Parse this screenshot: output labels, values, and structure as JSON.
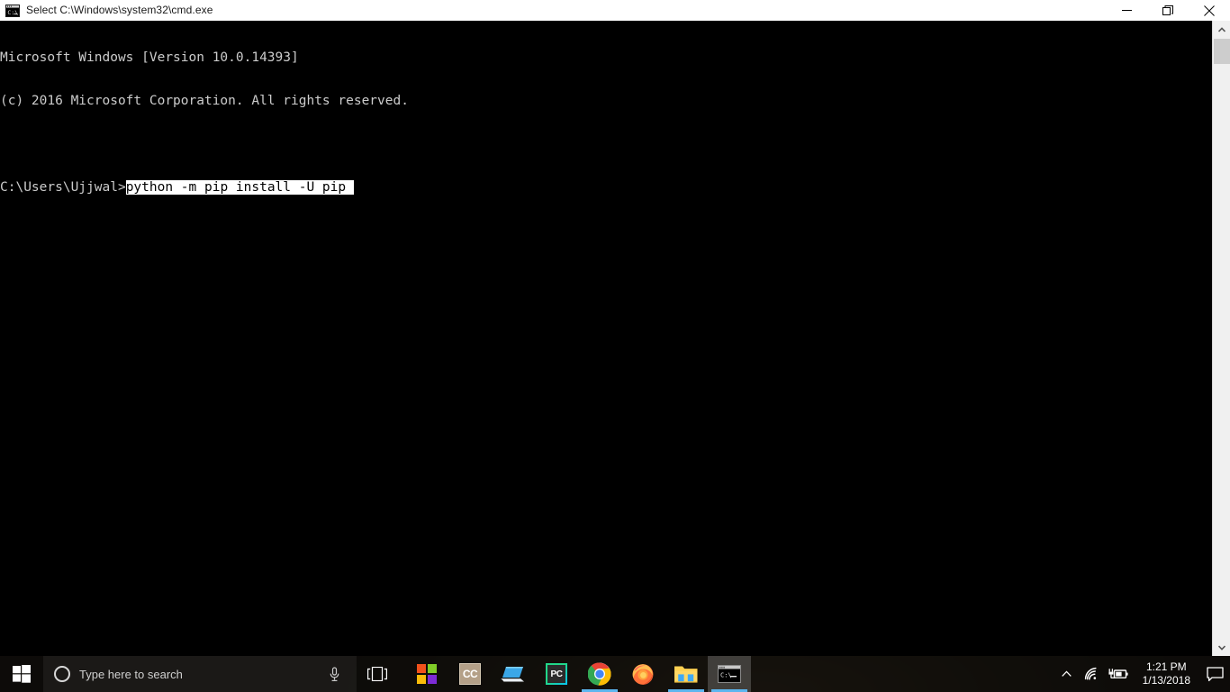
{
  "window": {
    "title": "Select C:\\Windows\\system32\\cmd.exe",
    "icon": "cmd-console-icon",
    "controls": {
      "minimize_label": "—",
      "restore_label": "❐",
      "close_label": "✕"
    }
  },
  "console": {
    "lines": [
      {
        "text": "Microsoft Windows [Version 10.0.14393]",
        "selected": false
      },
      {
        "text": "(c) 2016 Microsoft Corporation. All rights reserved.",
        "selected": false
      },
      {
        "text": "",
        "selected": false
      },
      {
        "prompt": "C:\\Users\\Ujjwal>",
        "command": "python -m pip install -U pip ",
        "selected": true
      }
    ],
    "prompt": "C:\\Users\\Ujjwal>",
    "command": "python -m pip install -U pip ",
    "foreground_color": "#cccccc",
    "background_color": "#000000",
    "selection_background": "#ffffff",
    "selection_foreground": "#000000"
  },
  "scrollbar": {
    "up_arrow": "▲",
    "down_arrow": "▼",
    "thumb_position_percent": 0
  },
  "taskbar": {
    "start_label": "Start",
    "search": {
      "placeholder": "Type here to search",
      "value": "",
      "cortana_icon": "cortana-circle-icon",
      "mic_icon": "microphone-icon"
    },
    "task_view_label": "Task View",
    "apps": [
      {
        "name": "microsoft-store",
        "label": "Microsoft Store",
        "running": false,
        "active": false
      },
      {
        "name": "cc-app",
        "label": "CC",
        "running": false,
        "active": false
      },
      {
        "name": "laptop-app",
        "label": "PC",
        "running": false,
        "active": false
      },
      {
        "name": "pycharm",
        "label": "PC",
        "running": false,
        "active": false
      },
      {
        "name": "google-chrome",
        "label": "Google Chrome",
        "running": true,
        "active": false
      },
      {
        "name": "mozilla-firefox",
        "label": "Mozilla Firefox",
        "running": false,
        "active": false
      },
      {
        "name": "file-explorer",
        "label": "File Explorer",
        "running": true,
        "active": false
      },
      {
        "name": "command-prompt",
        "label": "Command Prompt",
        "running": true,
        "active": true
      }
    ],
    "tray": {
      "show_hidden_label": "Show hidden icons",
      "wifi_label": "Network",
      "battery_label": "Battery charging",
      "time": "1:21 PM",
      "date": "1/13/2018",
      "action_center_label": "Action Center"
    }
  },
  "colors": {
    "accent": "#5cb6ef",
    "titlebar_bg": "#ffffff",
    "taskbar_bg": "#0e0c0a",
    "console_bg": "#000000"
  }
}
